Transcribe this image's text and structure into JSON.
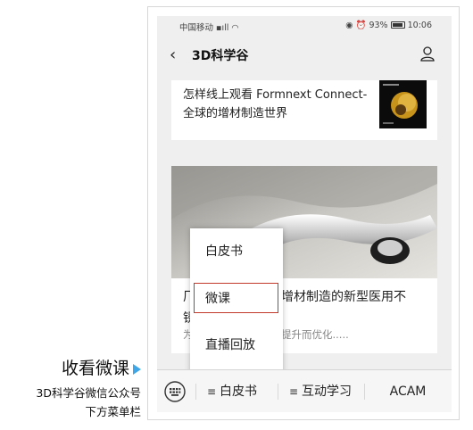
{
  "caption": {
    "main": "收看微课",
    "line1": "3D科学谷微信公众号",
    "line2": "下方菜单栏"
  },
  "status_bar": {
    "carrier": "中国移动",
    "battery": "93%",
    "time": "10:06"
  },
  "nav": {
    "title": "3D科学谷"
  },
  "article1": {
    "title": "怎样线上观看 Formnext Connect-全球的增材制造世界"
  },
  "article2": {
    "title_start": "厂",
    "title_end": "增材制造的新型医用不",
    "line2": "锈",
    "desc_start": "为",
    "desc_end": "提升而优化....."
  },
  "popup_menu": {
    "items": [
      "白皮书",
      "微课",
      "直播回放"
    ],
    "highlighted": "微课"
  },
  "bottom_menu": {
    "items": [
      "白皮书",
      "互动学习",
      "ACAM"
    ]
  },
  "colors": {
    "highlight_border": "#c0392b",
    "arrow": "#3fa7e8"
  },
  "icons": [
    "keyboard-icon",
    "menu-icon",
    "back-icon",
    "profile-icon",
    "battery-icon"
  ]
}
